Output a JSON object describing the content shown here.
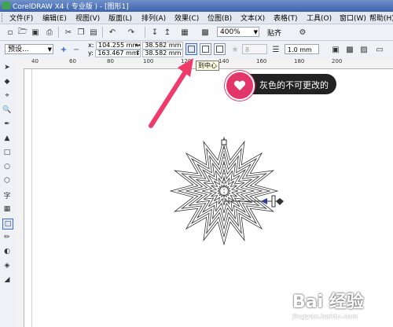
{
  "window": {
    "title": "CorelDRAW X4 ( 专业版 ) - [图形1]"
  },
  "menu": [
    {
      "label": "文件(F)"
    },
    {
      "label": "编辑(E)"
    },
    {
      "label": "视图(V)"
    },
    {
      "label": "版面(L)"
    },
    {
      "label": "排列(A)"
    },
    {
      "label": "效果(C)"
    },
    {
      "label": "位图(B)"
    },
    {
      "label": "文本(X)"
    },
    {
      "label": "表格(T)"
    },
    {
      "label": "工具(O)"
    },
    {
      "label": "窗口(W)"
    },
    {
      "label": "帮助(H)"
    }
  ],
  "toolbar": {
    "zoom_value": "400%",
    "snap_label": "贴齐"
  },
  "properties": {
    "preset": "预设...",
    "x_label": "x:",
    "x_value": "104.255 mm",
    "y_label": "y:",
    "y_value": "163.467 mm",
    "width_value": "38.582 mm",
    "height_value": "38.582 mm",
    "points_value": "8",
    "outline_value": "1.0 mm"
  },
  "tooltip": {
    "text": "到中心"
  },
  "callout": {
    "text": "灰色的不可更改的"
  },
  "ruler": {
    "h_labels": [
      "40",
      "60",
      "80",
      "100",
      "120",
      "140",
      "160",
      "180",
      "200"
    ]
  },
  "watermark": {
    "text": "Bai 经验",
    "sub": "jingyan.baidu.com"
  },
  "colors": {
    "callout_accent": "#e2366b",
    "arrow": "#f03a6a",
    "title_bar": "#3c63ad"
  }
}
